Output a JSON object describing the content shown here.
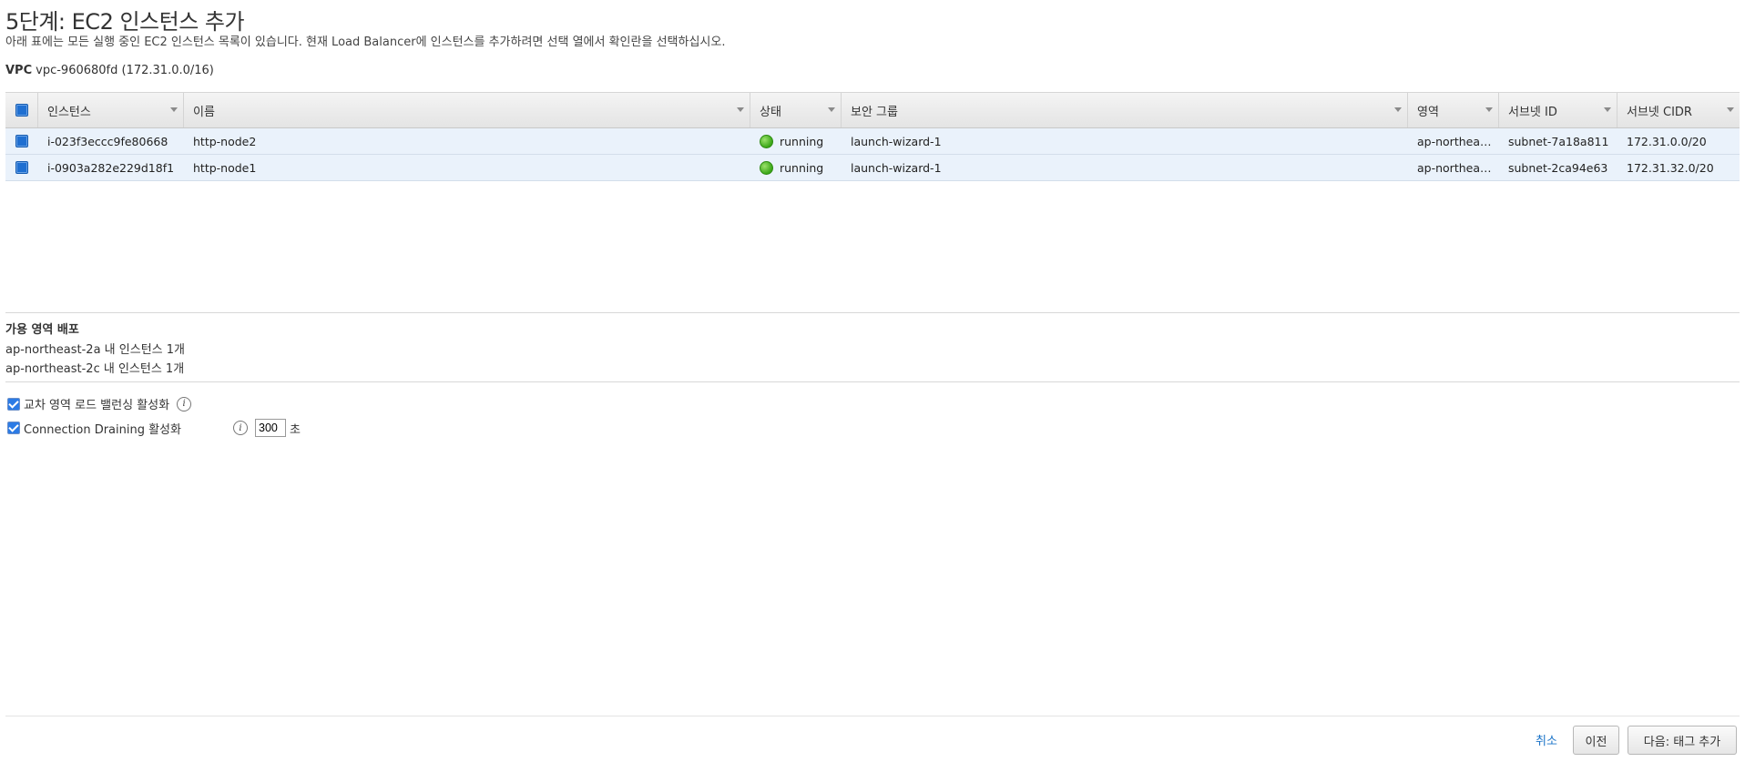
{
  "page": {
    "title": "5단계: EC2 인스턴스 추가",
    "description": "아래 표에는 모든 실행 중인 EC2 인스턴스 목록이 있습니다. 현재 Load Balancer에 인스턴스를 추가하려면 선택 열에서 확인란을 선택하십시오.",
    "vpc_label": "VPC",
    "vpc_value": "vpc-960680fd (172.31.0.0/16)"
  },
  "table": {
    "headers": [
      "인스턴스",
      "이름",
      "상태",
      "보안 그룹",
      "영역",
      "서브넷 ID",
      "서브넷 CIDR"
    ],
    "rows": [
      {
        "instance": "i-023f3eccc9fe80668",
        "name": "http-node2",
        "state": "running",
        "security_group": "launch-wizard-1",
        "zone": "ap-northea…",
        "subnet_id": "subnet-7a18a811",
        "subnet_cidr": "172.31.0.0/20"
      },
      {
        "instance": "i-0903a282e229d18f1",
        "name": "http-node1",
        "state": "running",
        "security_group": "launch-wizard-1",
        "zone": "ap-northea…",
        "subnet_id": "subnet-2ca94e63",
        "subnet_cidr": "172.31.32.0/20"
      }
    ]
  },
  "az": {
    "title": "가용 영역 배포",
    "lines": [
      "ap-northeast-2a 내 인스턴스 1개",
      "ap-northeast-2c 내 인스턴스 1개"
    ]
  },
  "options": {
    "cross_zone_label": "교차 영역 로드 밸런싱 활성화",
    "draining_label": "Connection Draining 활성화",
    "draining_value": "300",
    "draining_unit": "초"
  },
  "footer": {
    "cancel": "취소",
    "previous": "이전",
    "next": "다음: 태그 추가"
  },
  "colors": {
    "running": "#3aa617",
    "link": "#1a73c8",
    "row_selected": "#eaf2fb"
  }
}
